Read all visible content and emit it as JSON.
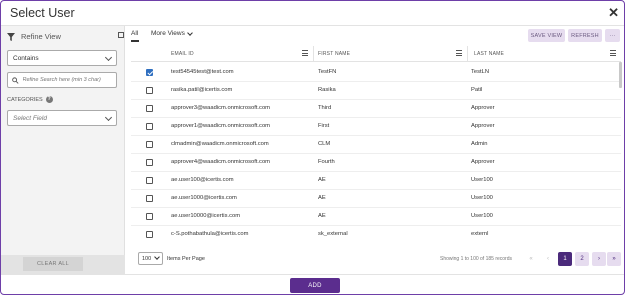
{
  "dialog": {
    "title": "Select User",
    "close_icon": "close-icon"
  },
  "refine": {
    "heading": "Refine View",
    "operator_value": "Contains",
    "search_placeholder": "Refine Search here (min 3 char)",
    "categories_label": "CATEGORIES",
    "field_placeholder": "Select Field",
    "clear_all": "CLEAR ALL"
  },
  "toolbar": {
    "tab_all": "All",
    "more_views": "More Views",
    "save_view": "SAVE VIEW",
    "refresh": "REFRESH",
    "more": "···"
  },
  "columns": [
    "EMAIL ID",
    "FIRST NAME",
    "LAST NAME"
  ],
  "rows": [
    {
      "checked": true,
      "email": "test54545test@test.com",
      "first": "TestFN",
      "last": "TestLN"
    },
    {
      "checked": false,
      "email": "rasika.patil@icertis.com",
      "first": "Rasika",
      "last": "Patil"
    },
    {
      "checked": false,
      "email": "approver3@waadicm.onmicrosoft.com",
      "first": "Third",
      "last": "Approver"
    },
    {
      "checked": false,
      "email": "approver1@waadicm.onmicrosoft.com",
      "first": "First",
      "last": "Approver"
    },
    {
      "checked": false,
      "email": "clmadmin@waadicm.onmicrosoft.com",
      "first": "CLM",
      "last": "Admin"
    },
    {
      "checked": false,
      "email": "approver4@waadicm.onmicrosoft.com",
      "first": "Fourth",
      "last": "Approver"
    },
    {
      "checked": false,
      "email": "ae.user100@icertis.com",
      "first": "AE",
      "last": "User100"
    },
    {
      "checked": false,
      "email": "ae.user1000@icertis.com",
      "first": "AE",
      "last": "User100"
    },
    {
      "checked": false,
      "email": "ae.user10000@icertis.com",
      "first": "AE",
      "last": "User100"
    },
    {
      "checked": false,
      "email": "c-S.pothabathula@icertis.com",
      "first": "sk_external",
      "last": "externl"
    }
  ],
  "pagination": {
    "per_page_value": "100",
    "per_page_label": "Items Per Page",
    "showing": "Showing 1 to 100 of 185 records",
    "first": "«",
    "prev": "‹",
    "page1": "1",
    "page2": "2",
    "next": "›",
    "last": "»"
  },
  "footer": {
    "add": "ADD"
  },
  "colors": {
    "accent": "#5b2d8e",
    "accent_light": "#e6dcef",
    "checkbox": "#2f6fc0"
  }
}
